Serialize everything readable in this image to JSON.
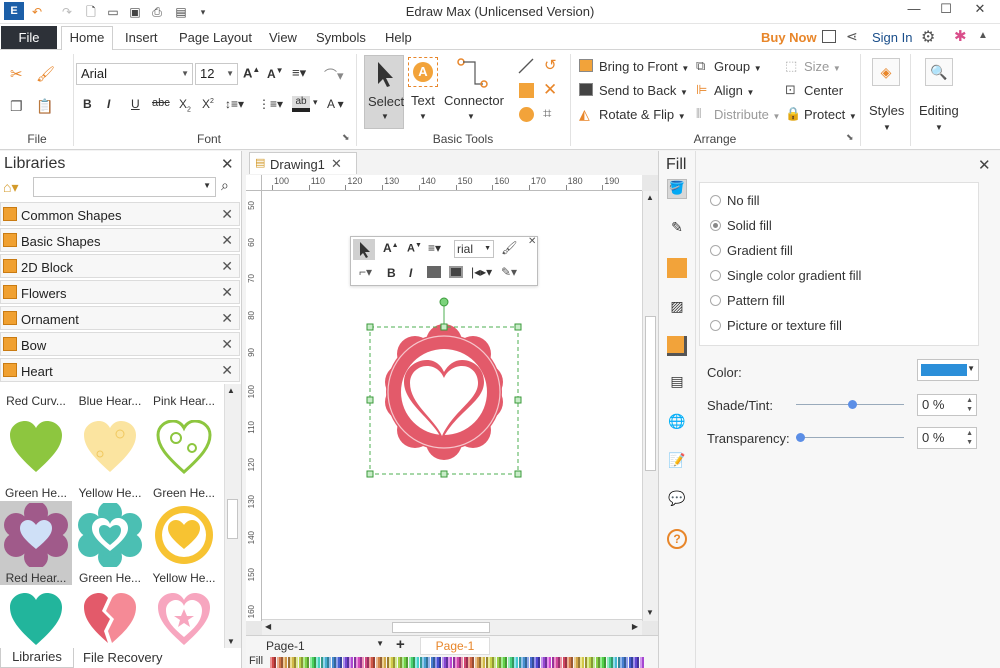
{
  "window": {
    "title": "Edraw Max (Unlicensed Version)"
  },
  "menu": {
    "file": "File",
    "tabs": [
      "Home",
      "Insert",
      "Page Layout",
      "View",
      "Symbols",
      "Help"
    ],
    "buy_now": "Buy Now",
    "sign_in": "Sign In"
  },
  "ribbon": {
    "groups": {
      "file": "File",
      "font": "Font",
      "basic_tools": "Basic Tools",
      "arrange": "Arrange"
    },
    "font_name": "Arial",
    "font_size": "12",
    "select": "Select",
    "text": "Text",
    "connector": "Connector",
    "bring_to_front": "Bring to Front",
    "send_to_back": "Send to Back",
    "rotate_flip": "Rotate & Flip",
    "group": "Group",
    "align": "Align",
    "distribute": "Distribute",
    "size": "Size",
    "center": "Center",
    "protect": "Protect",
    "styles": "Styles",
    "editing": "Editing"
  },
  "libraries": {
    "title": "Libraries",
    "categories": [
      "Common Shapes",
      "Basic Shapes",
      "2D Block",
      "Flowers",
      "Ornament",
      "Bow",
      "Heart"
    ],
    "thumbs_row0": [
      "Red Curv...",
      "Blue Hear...",
      "Pink Hear..."
    ],
    "thumbs_row1": [
      "Green He...",
      "Yellow He...",
      "Green He..."
    ],
    "thumbs_row2": [
      "Red Hear...",
      "Green He...",
      "Yellow He..."
    ],
    "bottom_tabs": [
      "Libraries",
      "File Recovery"
    ]
  },
  "document": {
    "tab": "Drawing1",
    "ruler_top": [
      "100",
      "110",
      "120",
      "130",
      "140",
      "150",
      "160",
      "170",
      "180",
      "190"
    ],
    "ruler_left": [
      "50",
      "60",
      "70",
      "80",
      "90",
      "100",
      "110",
      "120",
      "130",
      "140",
      "150",
      "160"
    ],
    "page_selector": "Page-1",
    "page_tab": "Page-1",
    "fill_label": "Fill",
    "float_font": "rial"
  },
  "fill_panel": {
    "title": "Fill",
    "options": [
      "No fill",
      "Solid fill",
      "Gradient fill",
      "Single color gradient fill",
      "Pattern fill",
      "Picture or texture fill"
    ],
    "selected": "Solid fill",
    "color_label": "Color:",
    "color_value": "#2b8fd9",
    "shade_label": "Shade/Tint:",
    "shade_value": "0 %",
    "shade_level": 0.5,
    "transparency_label": "Transparency:",
    "transparency_value": "0 %",
    "transparency_level": 0
  },
  "colors": {
    "accent_orange": "#e8862a",
    "shape_red": "#e35a6a",
    "file_button": "#2d3138"
  }
}
